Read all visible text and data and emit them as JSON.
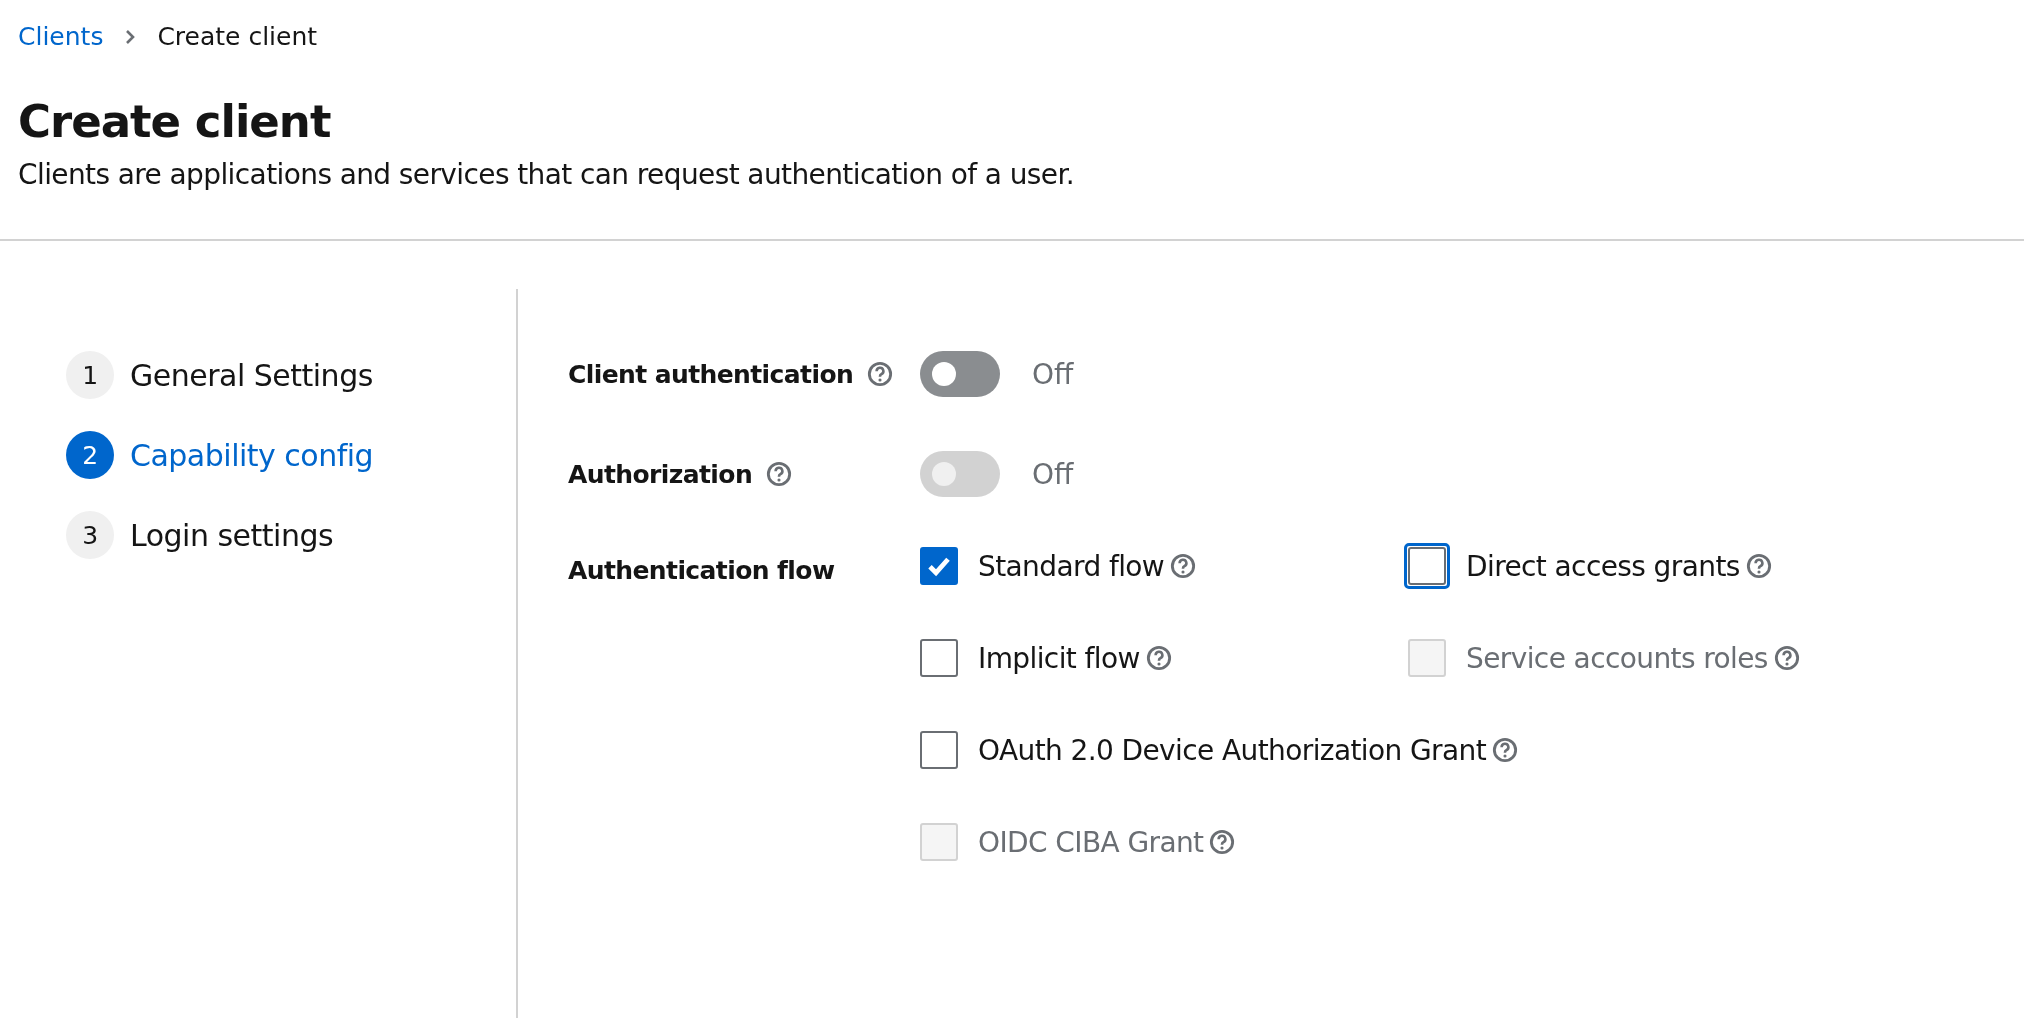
{
  "breadcrumb": [
    {
      "label": "Clients",
      "link": true
    },
    {
      "label": "Create client",
      "link": false
    }
  ],
  "page": {
    "title": "Create client",
    "description": "Clients are applications and services that can request authentication of a user."
  },
  "steps": [
    {
      "number": "1",
      "label": "General Settings",
      "selected": false
    },
    {
      "number": "2",
      "label": "Capability config",
      "selected": true
    },
    {
      "number": "3",
      "label": "Login settings",
      "selected": false
    }
  ],
  "switches": [
    {
      "label": "Client authentication",
      "on": false,
      "disabled": false,
      "state_text": "Off"
    },
    {
      "label": "Authorization",
      "on": false,
      "disabled": true,
      "state_text": "Off"
    }
  ],
  "authentication_flow": {
    "label": "Authentication flow",
    "options": [
      {
        "label": "Standard flow",
        "checked": true,
        "disabled": false,
        "focused": false
      },
      {
        "label": "Direct access grants",
        "checked": false,
        "disabled": false,
        "focused": true
      },
      {
        "label": "Implicit flow",
        "checked": false,
        "disabled": false,
        "focused": false
      },
      {
        "label": "Service accounts roles",
        "checked": false,
        "disabled": true,
        "focused": false
      },
      {
        "label": "OAuth 2.0 Device Authorization Grant",
        "checked": false,
        "disabled": false,
        "focused": false
      },
      {
        "label": "OIDC CIBA Grant",
        "checked": false,
        "disabled": true,
        "focused": false
      }
    ]
  }
}
